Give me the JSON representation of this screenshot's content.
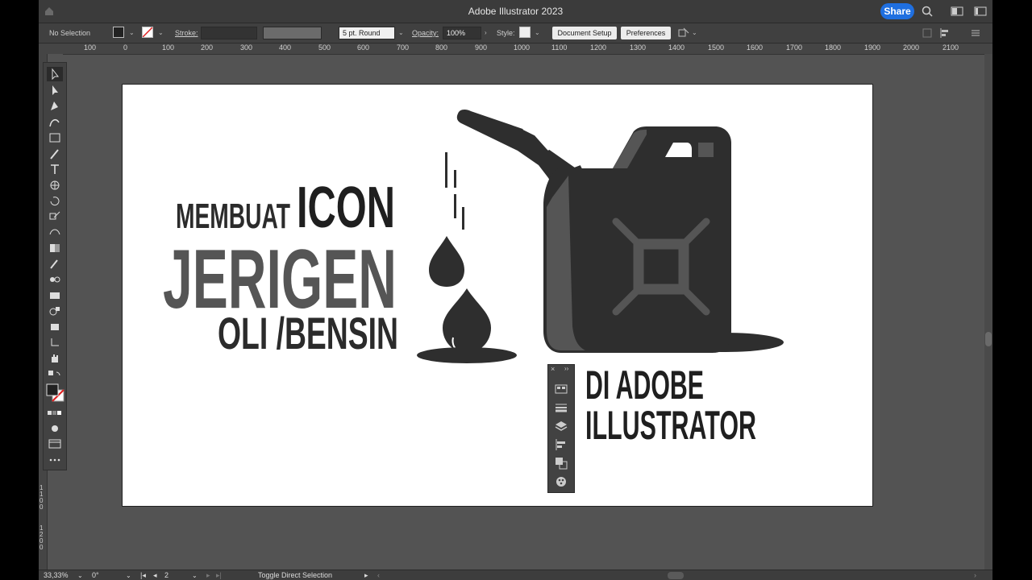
{
  "app": {
    "title": "Adobe Illustrator 2023",
    "share_label": "Share"
  },
  "control_bar": {
    "selection_label": "No Selection",
    "stroke_label": "Stroke:",
    "stroke_weight": "",
    "brush_label": "5 pt. Round",
    "opacity_label": "Opacity:",
    "opacity_value": "100%",
    "style_label": "Style:",
    "document_setup_label": "Document Setup",
    "preferences_label": "Preferences"
  },
  "ruler_h": [
    "100",
    "0",
    "100",
    "200",
    "300",
    "400",
    "500",
    "600",
    "700",
    "800",
    "900",
    "1000",
    "1100",
    "1200",
    "1300",
    "1400",
    "1500",
    "1600",
    "1700",
    "1800",
    "1900",
    "2000",
    "2100"
  ],
  "ruler_v": [
    "1100",
    "1200"
  ],
  "artwork": {
    "line_membuat": "MEMBUAT",
    "line_icon": "ICON",
    "line_jerigen": "JERIGEN",
    "line_oli": "OLI /BENSIN",
    "line_di_adobe": "DI ADOBE",
    "line_illustrator": "ILLUSTRATOR"
  },
  "tools": [
    "selection-tool",
    "direct-selection-tool",
    "pen-tool",
    "curvature-tool",
    "rectangle-tool",
    "paintbrush-tool",
    "type-tool",
    "shaper-tool",
    "rotate-tool",
    "scale-tool",
    "warp-tool",
    "gradient-tool",
    "eyedropper-tool",
    "blend-tool",
    "symbol-sprayer-tool",
    "graph-tool",
    "artboard-tool",
    "slice-tool",
    "hand-tool"
  ],
  "status_bar": {
    "zoom": "33,33%",
    "rotation": "0°",
    "artboard_number": "2",
    "status_text": "Toggle Direct Selection"
  },
  "colors": {
    "ui_bg": "#535353",
    "accent": "#1f6fe0",
    "art_dark": "#2e2e2e",
    "art_grey": "#555555"
  }
}
